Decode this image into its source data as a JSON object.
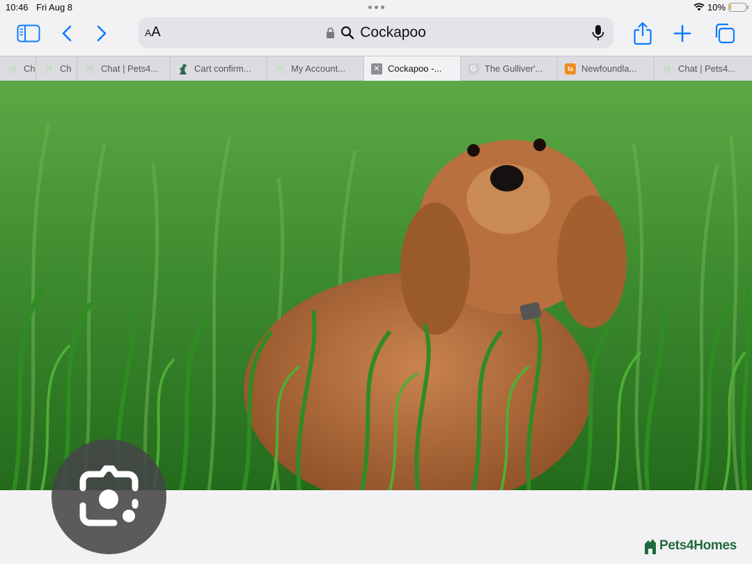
{
  "status_bar": {
    "time": "10:46",
    "date": "Fri Aug 8",
    "battery_text": "10%",
    "battery_level": 0.1
  },
  "toolbar": {
    "text_size_label_small": "A",
    "text_size_label_large": "A",
    "address_text": "Cockapoo"
  },
  "tabs": [
    {
      "title": "Ch",
      "favicon": "pets4homes-icon"
    },
    {
      "title": "Ch",
      "favicon": "pets4homes-icon"
    },
    {
      "title": "Chat | Pets4...",
      "favicon": "pets4homes-icon"
    },
    {
      "title": "Cart confirm...",
      "favicon": "dog-icon"
    },
    {
      "title": "My Account...",
      "favicon": "pets4homes-icon"
    },
    {
      "title": "Cockapoo -...",
      "favicon": "close-icon",
      "active": true
    },
    {
      "title": "The Gulliver'...",
      "favicon": "letter-g-icon",
      "favicon_text": "G"
    },
    {
      "title": "Newfoundla...",
      "favicon": "orange-site-icon",
      "favicon_text": "fa"
    },
    {
      "title": "Chat | Pets4...",
      "favicon": "pets4homes-icon"
    }
  ],
  "brand": {
    "name": "Pets4Homes"
  },
  "colors": {
    "brand_green": "#1f6b3d",
    "accent_blue": "#0a7aff"
  }
}
